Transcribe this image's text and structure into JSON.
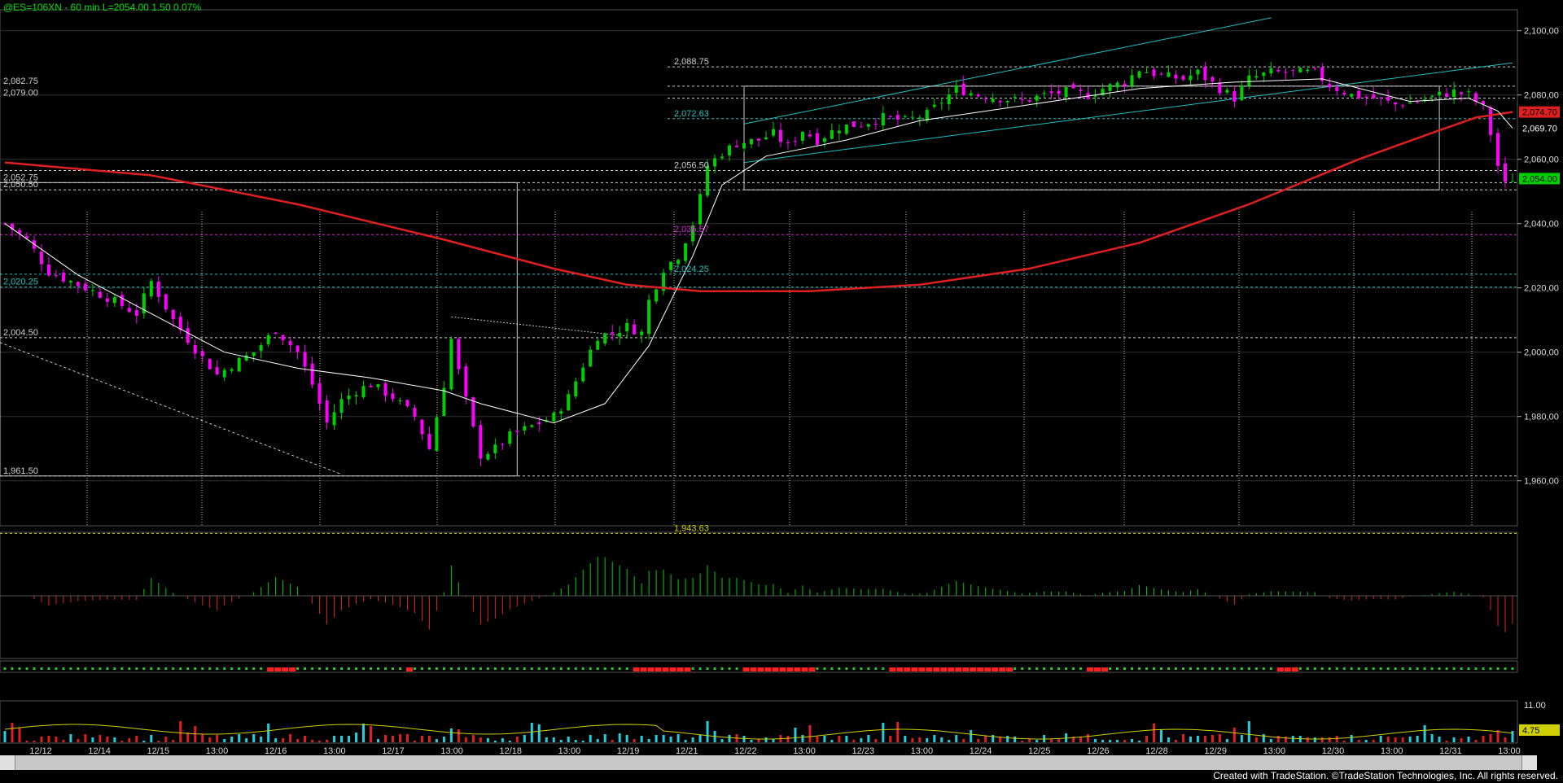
{
  "header": {
    "text": "@ES=106XN - 60 min  L=2054.00  1.50  0.07%"
  },
  "footer": {
    "text": "Created with TradeStation. ©TradeStation Technologies, Inc. All rights reserved."
  },
  "colors": {
    "bull": "#00d000",
    "bear": "#ff00ff",
    "ma_slow": "#e02020",
    "ma_fast": "#ffffff",
    "channel": "#20c0c0",
    "hist_pos": "#00d000",
    "hist_neg": "#e02020",
    "vol_up": "#20d0e0",
    "vol_dn": "#e02020",
    "vol_avg": "#d0d000"
  },
  "chart_data": {
    "type": "candlestick",
    "symbol": "@ES=106XN - 60 min",
    "last": 2054.0,
    "change": 1.5,
    "change_pct": "0.07%",
    "ylim": [
      1946,
      2106
    ],
    "y_ticks": [
      1960,
      1980,
      2000,
      2020,
      2040,
      2060,
      2080,
      2100
    ],
    "y_tick_labels": [
      "1,960,00",
      "1,980,00",
      "2,000,00",
      "2,020,00",
      "2,040,00",
      "2,060,00",
      "2,080,00",
      "2,100,00"
    ],
    "x_labels": [
      "12/12",
      "12/14",
      "12/15",
      "13:00",
      "12/16",
      "13:00",
      "12/17",
      "13:00",
      "12/18",
      "13:00",
      "12/19",
      "12/21",
      "12/22",
      "13:00",
      "12/23",
      "13:00",
      "12/24",
      "12/25",
      "12/26",
      "12/28",
      "12/29",
      "13:00",
      "12/30",
      "13:00",
      "12/31",
      "13:00"
    ],
    "close_path": [
      [
        0,
        2040
      ],
      [
        3,
        2035
      ],
      [
        6,
        2025
      ],
      [
        10,
        2021
      ],
      [
        14,
        2017
      ],
      [
        18,
        2012
      ],
      [
        20,
        2022
      ],
      [
        23,
        2010
      ],
      [
        26,
        2001
      ],
      [
        29,
        1993
      ],
      [
        31,
        1996
      ],
      [
        34,
        2000
      ],
      [
        37,
        2007
      ],
      [
        40,
        2000
      ],
      [
        42,
        1990
      ],
      [
        44,
        1978
      ],
      [
        46,
        1985
      ],
      [
        48,
        1988
      ],
      [
        50,
        1990
      ],
      [
        53,
        1986
      ],
      [
        56,
        1980
      ],
      [
        58,
        1970
      ],
      [
        60,
        1990
      ],
      [
        61,
        2004
      ],
      [
        62,
        1994
      ],
      [
        64,
        1976
      ],
      [
        65,
        1968
      ],
      [
        67,
        1970
      ],
      [
        69,
        1974
      ],
      [
        72,
        1977
      ],
      [
        75,
        1980
      ],
      [
        77,
        1986
      ],
      [
        79,
        1996
      ],
      [
        81,
        2005
      ],
      [
        83,
        2006
      ],
      [
        85,
        2008
      ],
      [
        87,
        2006
      ],
      [
        88,
        2016
      ],
      [
        90,
        2026
      ],
      [
        92,
        2030
      ],
      [
        94,
        2040
      ],
      [
        95,
        2048
      ],
      [
        96,
        2058
      ],
      [
        98,
        2062
      ],
      [
        100,
        2065
      ],
      [
        103,
        2066
      ],
      [
        105,
        2068
      ],
      [
        107,
        2064
      ],
      [
        109,
        2069
      ],
      [
        111,
        2066
      ],
      [
        114,
        2070
      ],
      [
        117,
        2071
      ],
      [
        120,
        2073
      ],
      [
        123,
        2072
      ],
      [
        126,
        2074
      ],
      [
        128,
        2078
      ],
      [
        130,
        2082
      ],
      [
        133,
        2080
      ],
      [
        136,
        2079
      ],
      [
        139,
        2078
      ],
      [
        142,
        2080
      ],
      [
        145,
        2081
      ],
      [
        148,
        2080
      ],
      [
        150,
        2082
      ],
      [
        153,
        2084
      ],
      [
        155,
        2088
      ],
      [
        158,
        2086
      ],
      [
        161,
        2085
      ],
      [
        163,
        2087
      ],
      [
        166,
        2082
      ],
      [
        168,
        2079
      ],
      [
        170,
        2085
      ],
      [
        173,
        2087
      ],
      [
        176,
        2087
      ],
      [
        179,
        2087
      ],
      [
        181,
        2083
      ],
      [
        184,
        2080
      ],
      [
        187,
        2079
      ],
      [
        190,
        2077
      ],
      [
        193,
        2078
      ],
      [
        196,
        2080
      ],
      [
        198,
        2081
      ],
      [
        200,
        2080
      ],
      [
        202,
        2076
      ],
      [
        203,
        2068
      ],
      [
        204,
        2058
      ],
      [
        205,
        2052
      ],
      [
        206,
        2054
      ]
    ],
    "ma_slow_path": [
      [
        0,
        2059
      ],
      [
        20,
        2055
      ],
      [
        40,
        2046
      ],
      [
        60,
        2035
      ],
      [
        75,
        2026
      ],
      [
        85,
        2021
      ],
      [
        95,
        2019
      ],
      [
        110,
        2019
      ],
      [
        125,
        2021
      ],
      [
        140,
        2026
      ],
      [
        155,
        2034
      ],
      [
        170,
        2046
      ],
      [
        185,
        2060
      ],
      [
        196,
        2069
      ],
      [
        201,
        2073
      ],
      [
        206,
        2074.7
      ]
    ],
    "ma_fast_path": [
      [
        0,
        2040
      ],
      [
        10,
        2024
      ],
      [
        20,
        2012
      ],
      [
        30,
        2000
      ],
      [
        40,
        1995
      ],
      [
        50,
        1992
      ],
      [
        60,
        1988
      ],
      [
        65,
        1984
      ],
      [
        75,
        1978
      ],
      [
        82,
        1984
      ],
      [
        88,
        2002
      ],
      [
        94,
        2030
      ],
      [
        98,
        2052
      ],
      [
        104,
        2061
      ],
      [
        115,
        2066
      ],
      [
        125,
        2072
      ],
      [
        140,
        2077
      ],
      [
        155,
        2082
      ],
      [
        168,
        2084
      ],
      [
        180,
        2085
      ],
      [
        192,
        2078
      ],
      [
        200,
        2079
      ],
      [
        204,
        2075
      ],
      [
        206,
        2069.7
      ]
    ],
    "horizontal_levels": [
      {
        "value": 2088.75,
        "label": "2,088.75",
        "color": "#d0d0d0"
      },
      {
        "value": 2082.75,
        "label": "2,082.75",
        "color": "#d0d0d0"
      },
      {
        "value": 2079.0,
        "label": "2,079.00",
        "color": "#d0d0d0"
      },
      {
        "value": 2072.63,
        "label": "2,072.63",
        "color": "#20c0c0"
      },
      {
        "value": 2056.5,
        "label": "2,056.50",
        "color": "#d0d0d0"
      },
      {
        "value": 2052.75,
        "label": "2,052.75",
        "color": "#d0d0d0"
      },
      {
        "value": 2050.5,
        "label": "2,050.50",
        "color": "#d0d0d0"
      },
      {
        "value": 2036.57,
        "label": "2,036.57",
        "color": "#e020e0"
      },
      {
        "value": 2024.25,
        "label": "2,024.25",
        "color": "#20c0c0"
      },
      {
        "value": 2020.25,
        "label": "2,020.25",
        "color": "#20c0c0"
      },
      {
        "value": 2004.5,
        "label": "2,004.50",
        "color": "#d0d0d0"
      },
      {
        "value": 1961.5,
        "label": "1,961.50",
        "color": "#d0d0d0"
      },
      {
        "value": 1943.63,
        "label": "1,943.63",
        "color": "#d0d000"
      }
    ],
    "price_markers": [
      {
        "value": 2074.7,
        "label": "2,074.70",
        "color": "#e02020"
      },
      {
        "value": 2069.7,
        "label": "2,069.70",
        "color": "#ffffff"
      },
      {
        "value": 2054.0,
        "label": "2,054.00",
        "color": "#00d000"
      }
    ],
    "volume_axis_labels": [
      "11.00",
      "4.75"
    ]
  }
}
